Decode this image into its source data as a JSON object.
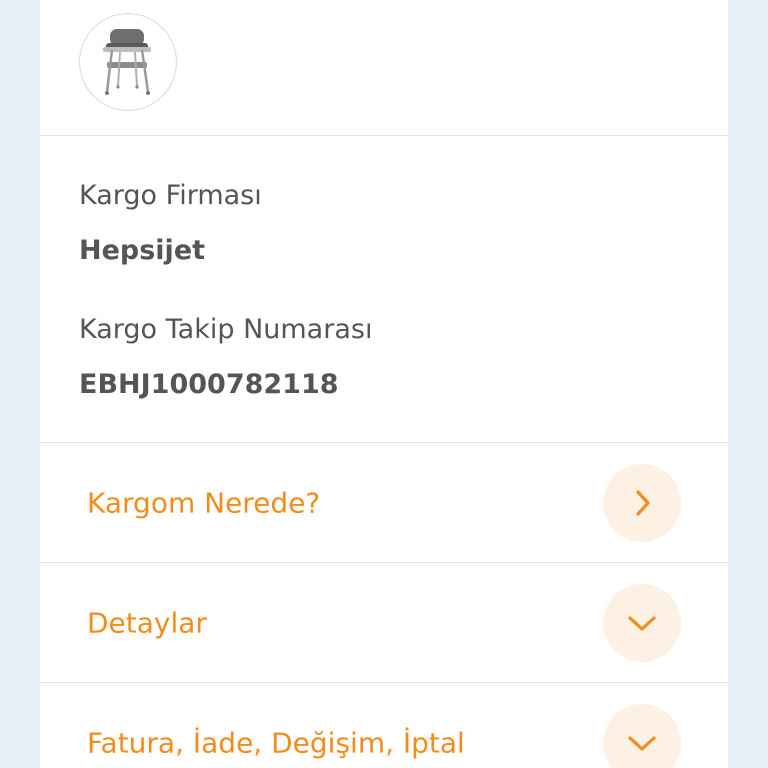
{
  "shipping": {
    "carrier_label": "Kargo Firması",
    "carrier_value": "Hepsijet",
    "tracking_label": "Kargo Takip Numarası",
    "tracking_value": "EBHJ1000782118"
  },
  "actions": [
    {
      "label": "Kargom Nerede?",
      "icon": "chevron-right-icon"
    },
    {
      "label": "Detaylar",
      "icon": "chevron-down-icon"
    },
    {
      "label": "Fatura, İade, Değişim, İptal",
      "icon": "chevron-down-icon"
    }
  ],
  "colors": {
    "accent": "#f28c1a",
    "accent_bg": "#fdf1e4",
    "text": "#555555",
    "page_bg": "#e9f1f8"
  }
}
